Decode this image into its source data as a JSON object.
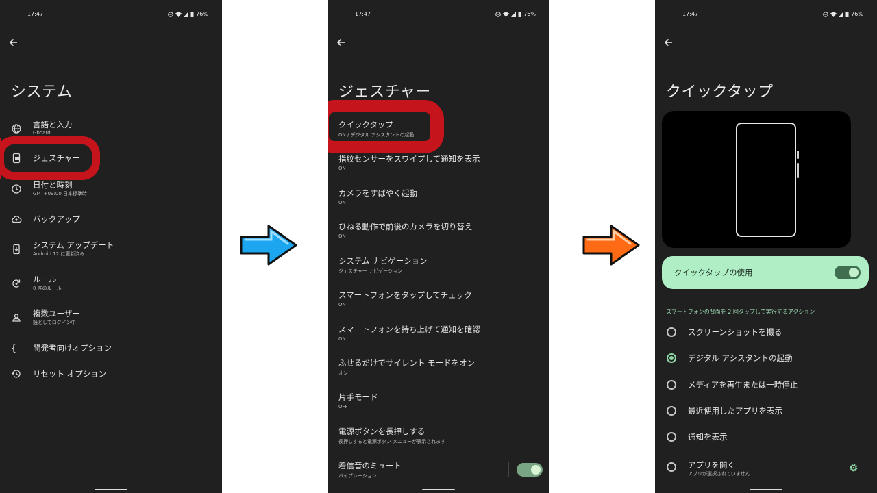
{
  "colors": {
    "highlight": "#c5141c",
    "panel_bg": "#1f201f",
    "accent_green": "#b0efc6",
    "arrow_blue": "#1da6f0",
    "arrow_orange": "#ff6a14"
  },
  "status": {
    "time": "17:47",
    "battery": "76%"
  },
  "screen1": {
    "title": "システム",
    "items": [
      {
        "label": "言語と入力",
        "sub": "Gboard",
        "icon": "globe-icon"
      },
      {
        "label": "ジェスチャー",
        "icon": "gesture-phone-icon"
      },
      {
        "label": "日付と時刻",
        "sub": "GMT+09:00 日本標準時",
        "icon": "clock-icon"
      },
      {
        "label": "バックアップ",
        "icon": "cloud-upload-icon"
      },
      {
        "label": "システム アップデート",
        "sub": "Android 12 に更新済み",
        "icon": "system-update-icon"
      },
      {
        "label": "ルール",
        "sub": "0 件のルール",
        "icon": "rules-icon"
      },
      {
        "label": "複数ユーザー",
        "sub": "鏡としてログイン中",
        "icon": "person-icon"
      },
      {
        "label": "開発者向けオプション",
        "icon": "braces-icon"
      },
      {
        "label": "リセット オプション",
        "icon": "history-icon"
      }
    ]
  },
  "screen2": {
    "title": "ジェスチャー",
    "items": [
      {
        "label": "クイックタップ",
        "sub": "ON / デジタル アシスタントの起動"
      },
      {
        "label": "指紋センサーをスワイプして通知を表示",
        "sub": "ON"
      },
      {
        "label": "カメラをすばやく起動",
        "sub": "ON"
      },
      {
        "label": "ひねる動作で前後のカメラを切り替え",
        "sub": "ON"
      },
      {
        "label": "システム ナビゲーション",
        "sub": "ジェスチャー ナビゲーション"
      },
      {
        "label": "スマートフォンをタップしてチェック",
        "sub": "ON"
      },
      {
        "label": "スマートフォンを持ち上げて通知を確認",
        "sub": "ON"
      },
      {
        "label": "ふせるだけでサイレント モードをオン",
        "sub": "オン"
      },
      {
        "label": "片手モード",
        "sub": "OFF"
      },
      {
        "label": "電源ボタンを長押しする",
        "sub": "長押しすると電源ボタン メニューが表示されます"
      },
      {
        "label": "着信音のミュート",
        "sub": "バイブレーション"
      }
    ]
  },
  "screen3": {
    "title": "クイックタップ",
    "use_label": "クイックタップの使用",
    "use_enabled": true,
    "section_label": "スマートフォンの背面を 2 回タップして実行するアクション",
    "options": [
      {
        "label": "スクリーンショットを撮る",
        "selected": false
      },
      {
        "label": "デジタル アシスタントの起動",
        "selected": true
      },
      {
        "label": "メディアを再生または一時停止",
        "selected": false
      },
      {
        "label": "最近使用したアプリを表示",
        "selected": false
      },
      {
        "label": "通知を表示",
        "selected": false
      },
      {
        "label": "アプリを開く",
        "sub": "アプリが選択されていません",
        "selected": false
      }
    ]
  }
}
